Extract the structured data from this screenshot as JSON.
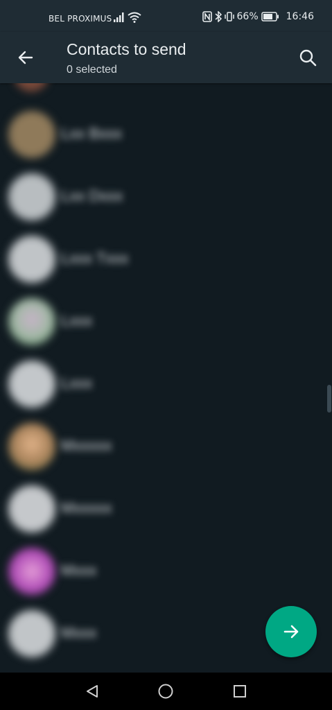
{
  "status_bar": {
    "carrier": "BEL PROXIMUS",
    "battery_percent": "66%",
    "time": "16:46"
  },
  "header": {
    "title": "Contacts to send",
    "subtitle": "0 selected",
    "back_icon": "arrow-left-icon",
    "search_icon": "search-icon"
  },
  "contacts": [
    {
      "name": "Lxx Bxxx",
      "avatar_color": "#8f7a5a"
    },
    {
      "name": "Lxx Dxxx",
      "avatar_color": "#b8bdc0"
    },
    {
      "name": "Lxxx Txxx",
      "avatar_color": "#c0c4c7"
    },
    {
      "name": "Lxxx",
      "avatar_color": "#a7b8a9"
    },
    {
      "name": "Lxxx",
      "avatar_color": "#c3c7ca"
    },
    {
      "name": "Mxxxxx",
      "avatar_color": "#a7815a"
    },
    {
      "name": "Mxxxxx",
      "avatar_color": "#c5c8cb"
    },
    {
      "name": "Mxxx",
      "avatar_color": "#b14fb8"
    },
    {
      "name": "Mxxx",
      "avatar_color": "#c1c5c8"
    }
  ],
  "colors": {
    "background": "#111b21",
    "header": "#1f2c34",
    "accent": "#00a884"
  },
  "fab_icon": "arrow-right-icon",
  "nav": {
    "back": "nav-back-icon",
    "home": "nav-home-icon",
    "recents": "nav-recents-icon"
  }
}
